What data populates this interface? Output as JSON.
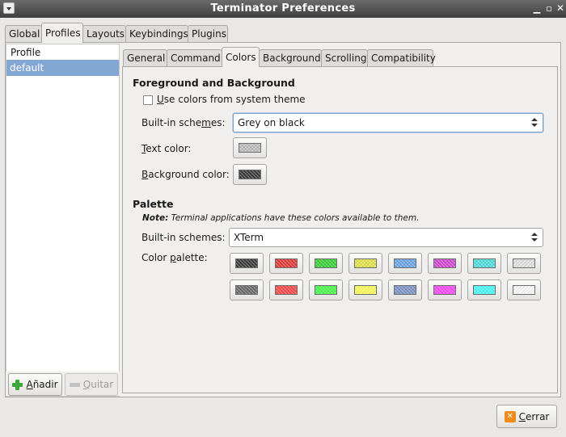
{
  "window": {
    "title": "Terminator Preferences"
  },
  "main_tabs": [
    "Global",
    "Profiles",
    "Layouts",
    "Keybindings",
    "Plugins"
  ],
  "profiles": {
    "header": "Profile",
    "items": [
      "default"
    ],
    "add_label": "Añadir",
    "remove_label": "Quitar"
  },
  "profile_tabs": [
    "General",
    "Command",
    "Colors",
    "Background",
    "Scrolling",
    "Compatibility"
  ],
  "colors": {
    "fg_bg_title": "Foreground and Background",
    "use_system_label": "Use colors from system theme",
    "use_system_checked": false,
    "scheme_label": "Built-in schemes:",
    "scheme_value": "Grey on black",
    "text_color_label": "Text color:",
    "text_color": "#c0c0c0",
    "bg_color_label": "Background color:",
    "bg_color": "#3c3c3c",
    "palette_title": "Palette",
    "note_bold": "Note:",
    "note_text": " Terminal applications have these colors available to them.",
    "palette_scheme_label": "Built-in schemes:",
    "palette_scheme_value": "XTerm",
    "palette_label": "Color palette:",
    "palette_row1": [
      "#3c3c3c",
      "#e83a3a",
      "#3ad43a",
      "#e6e64a",
      "#6ea8ec",
      "#d84ad8",
      "#52e0e0",
      "#e4e4e4"
    ],
    "palette_row2": [
      "#6c6c6c",
      "#ff4a4a",
      "#4aff4a",
      "#ffff5a",
      "#7e96c8",
      "#ff4aff",
      "#4affff",
      "#ffffff"
    ]
  },
  "footer": {
    "close_label": "Cerrar"
  }
}
